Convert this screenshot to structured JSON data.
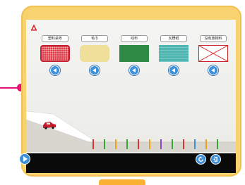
{
  "materials": [
    {
      "label": "塑料桌布",
      "swatch": "plastic-tablecloth-red-grid"
    },
    {
      "label": "毛巾",
      "swatch": "towel-cream"
    },
    {
      "label": "线布",
      "swatch": "cotton-cloth-green"
    },
    {
      "label": "瓦楞纸",
      "swatch": "corrugated-paper-teal"
    },
    {
      "label": "没有放物料",
      "swatch": "empty-crossed-out"
    }
  ],
  "colors": {
    "tablet_frame": "#f9d270",
    "accent_blue": "#3f8fd8",
    "bottom_bar": "#0a0a0a",
    "connector": "#e8117a",
    "car": "#c81e2b",
    "home_button": "#f9b233"
  },
  "icons": {
    "app_logo": "red-warning-logo-icon",
    "sound": "speaker-icon",
    "play": "play-icon",
    "reset": "refresh-icon",
    "back": "back-icon"
  }
}
